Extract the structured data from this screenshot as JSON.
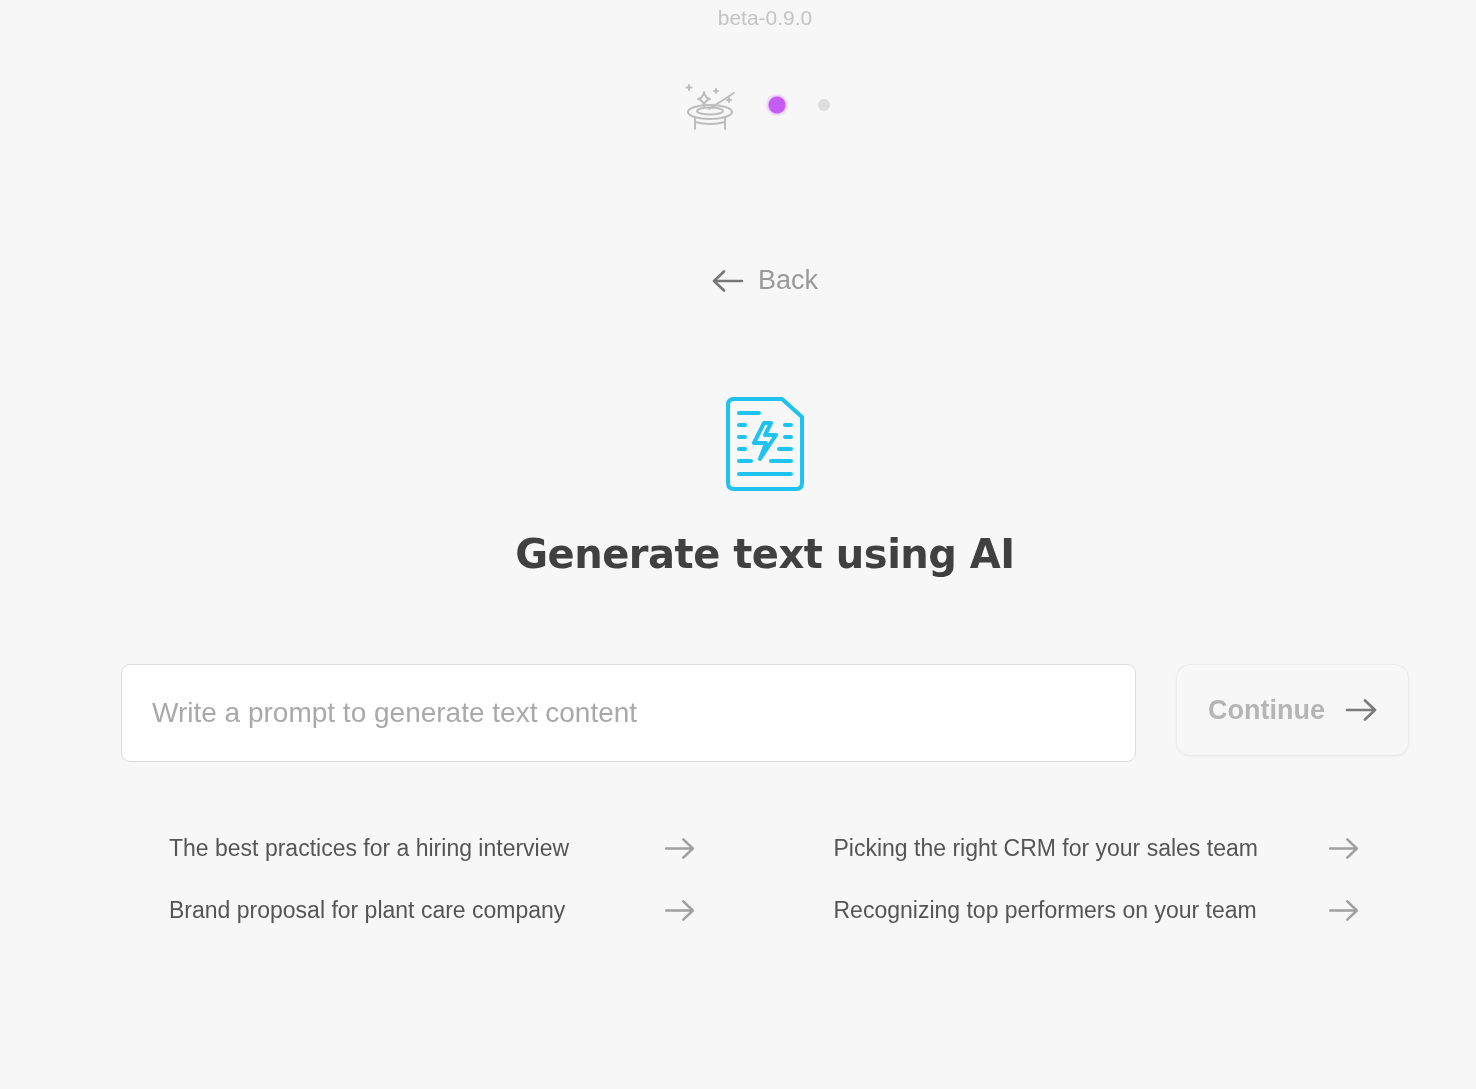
{
  "version": "beta-0.9.0",
  "steps": [
    {
      "selected": true
    },
    {
      "selected": false
    }
  ],
  "back": {
    "label": "Back"
  },
  "title": "Generate text using AI",
  "prompt": {
    "placeholder": "Write a prompt to generate text content"
  },
  "continue_button": {
    "label": "Continue",
    "disabled": true
  },
  "suggestions": [
    "The best practices for a hiring interview",
    "Picking the right CRM for your sales team",
    "Brand proposal for plant care company",
    "Recognizing top performers on your team"
  ]
}
